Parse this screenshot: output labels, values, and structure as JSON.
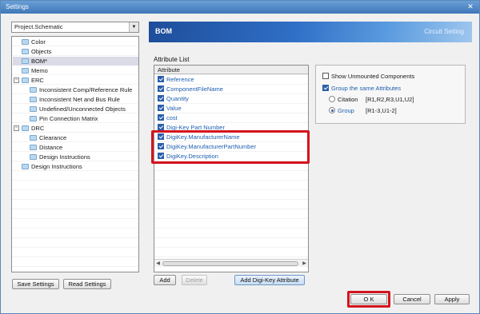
{
  "window": {
    "title": "Settings",
    "close": "✕"
  },
  "project_select": {
    "value": "Project.Schematic",
    "arrow": "▼"
  },
  "tree": {
    "items": [
      {
        "label": "Color"
      },
      {
        "label": "Objects"
      },
      {
        "label": "BOM*"
      },
      {
        "label": "Memo"
      },
      {
        "label": "ERC"
      },
      {
        "label": "Inconsistent Comp/Reference Rule"
      },
      {
        "label": "Inconsistent Net and Bus Rule"
      },
      {
        "label": "Undefined/Unconnected Objects"
      },
      {
        "label": "Pin Connection Matrix"
      },
      {
        "label": "DRC"
      },
      {
        "label": "Clearance"
      },
      {
        "label": "Distance"
      },
      {
        "label": "Design Instructions"
      },
      {
        "label": "Design Instructions"
      }
    ],
    "expander": "−"
  },
  "left_buttons": {
    "save": "Save Settings",
    "read": "Read Settings"
  },
  "header": {
    "title": "BOM",
    "subtitle": "Circuit Setting"
  },
  "attribute_list": {
    "label": "Attribute List",
    "column": "Attribute",
    "rows": [
      {
        "label": "Reference"
      },
      {
        "label": "ComponentFileName"
      },
      {
        "label": "Quantity"
      },
      {
        "label": "Value"
      },
      {
        "label": "cost"
      },
      {
        "label": "Digi-Key Part Number"
      },
      {
        "label": "DigiKey.ManufacturerName"
      },
      {
        "label": "DigiKey.ManufacturerPartNumber"
      },
      {
        "label": "DigiKey.Description"
      }
    ]
  },
  "list_buttons": {
    "add": "Add",
    "delete": "Delete",
    "add_digikey": "Add Digi-Key Attribute"
  },
  "options": {
    "show_unmounted": "Show Unmounted Components",
    "group_same": "Group the same Attributes",
    "citation_label": "Citation",
    "citation_example": "[R1,R2,R3,U1,U2]",
    "group_label": "Group",
    "group_example": "[R1-3,U1-2]"
  },
  "footer_buttons": {
    "ok": "O K",
    "cancel": "Cancel",
    "apply": "Apply"
  },
  "colors": {
    "accent": "#2b5fab",
    "highlight": "#d4141d",
    "title_bar": "#3f77b8"
  }
}
